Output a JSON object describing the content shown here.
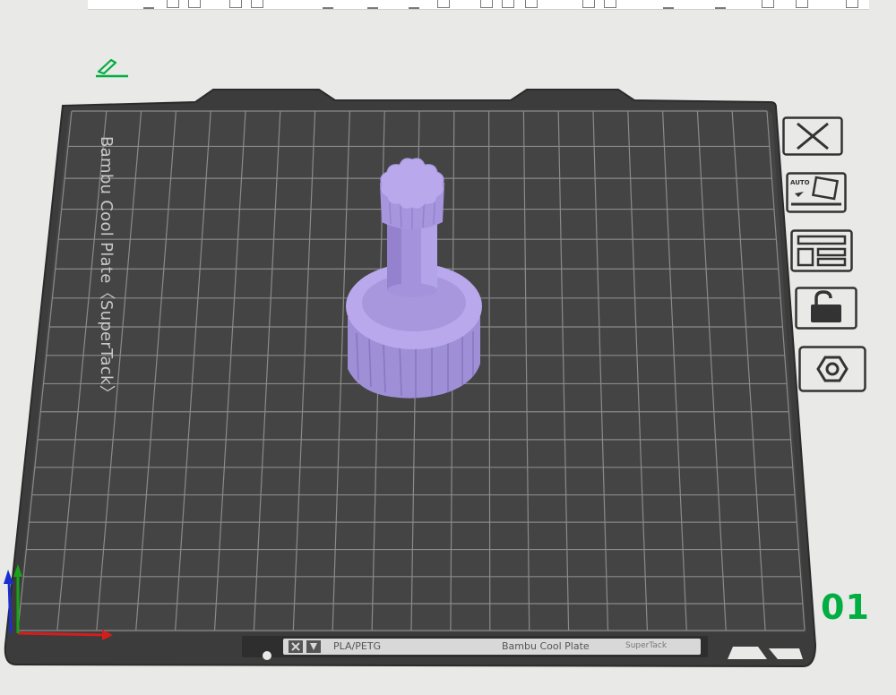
{
  "plate": {
    "name": "Bambu Cool Plate〈SuperTack〉",
    "number": "01",
    "filament_label": "PLA/PETG",
    "plate_type_label": "Bambu Cool Plate",
    "plate_type_sub": "SuperTack"
  },
  "side_toolbar": {
    "items": [
      {
        "icon": "close-icon",
        "label": "Remove plate"
      },
      {
        "icon": "auto-orient-icon",
        "label": "Auto orient"
      },
      {
        "icon": "arrange-icon",
        "label": "Arrange"
      },
      {
        "icon": "unlock-icon",
        "label": "Lock plate"
      },
      {
        "icon": "settings-hex-icon",
        "label": "Plate settings"
      }
    ]
  },
  "colors": {
    "accent": "#00ae42",
    "model": "#b7a6e6",
    "bed": "#3e3e3e",
    "grid": "#8a8a8a",
    "background": "#e9e9e7"
  }
}
